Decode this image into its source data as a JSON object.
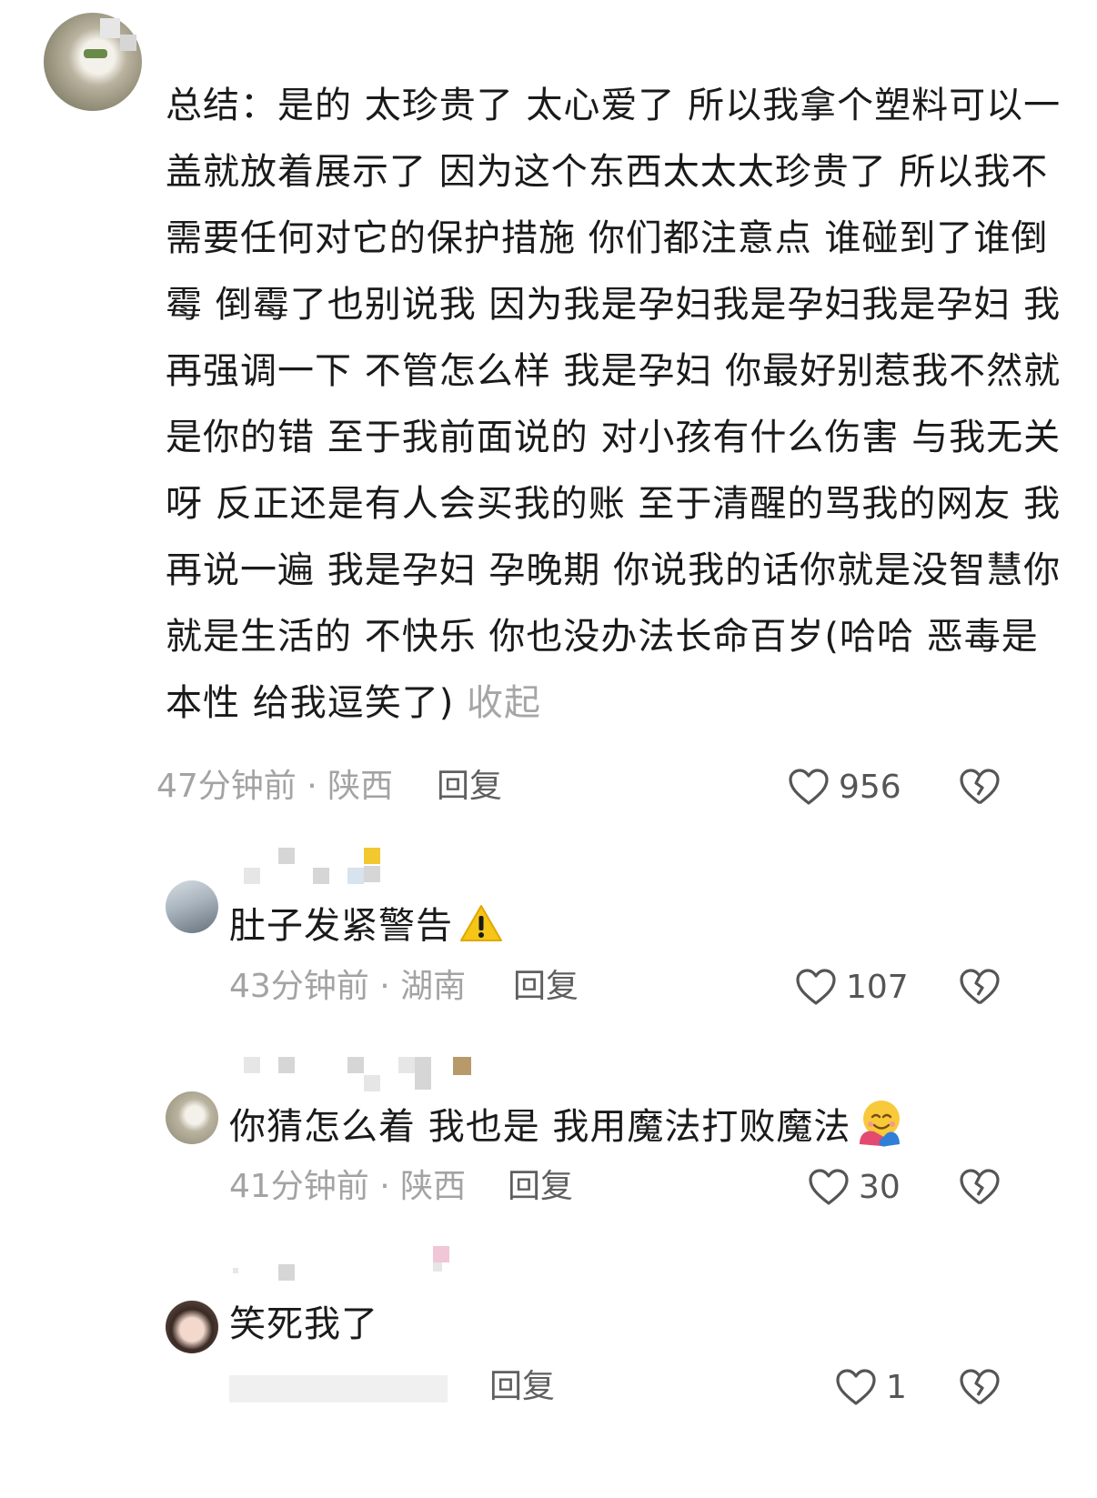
{
  "main_comment": {
    "text": "总结：是的 太珍贵了 太心爱了 所以我拿个塑料可以一盖就放着展示了 因为这个东西太太太珍贵了 所以我不需要任何对它的保护措施 你们都注意点 谁碰到了谁倒霉 倒霉了也别说我 因为我是孕妇我是孕妇我是孕妇 我再强调一下 不管怎么样 我是孕妇 你最好别惹我不然就是你的错 至于我前面说的 对小孩有什么伤害 与我无关呀 反正还是有人会买我的账 至于清醒的骂我的网友 我再说一遍 我是孕妇 孕晚期 你说我的话你就是没智慧你就是生活的 不快乐 你也没办法长命百岁(哈哈 恶毒是本性 给我逗笑了)",
    "collapse_label": "收起",
    "time_location": "47分钟前 · 陕西",
    "reply_label": "回复",
    "likes": "956"
  },
  "replies": [
    {
      "text": "肚子发紧警告",
      "emoji": "warning-icon",
      "time_location": "43分钟前 · 湖南",
      "reply_label": "回复",
      "likes": "107"
    },
    {
      "text": "你猜怎么着 我也是 我用魔法打败魔法",
      "emoji": "hugging-face-icon",
      "time_location": "41分钟前 · 陕西",
      "reply_label": "回复",
      "likes": "30"
    },
    {
      "text": "笑死我了",
      "emoji": "",
      "time_location": "",
      "reply_label": "回复",
      "likes": "1"
    }
  ],
  "colors": {
    "text": "#1a1a1a",
    "meta": "#a3a3a3",
    "reply": "#5f5f5f",
    "warning": "#f5c518"
  }
}
